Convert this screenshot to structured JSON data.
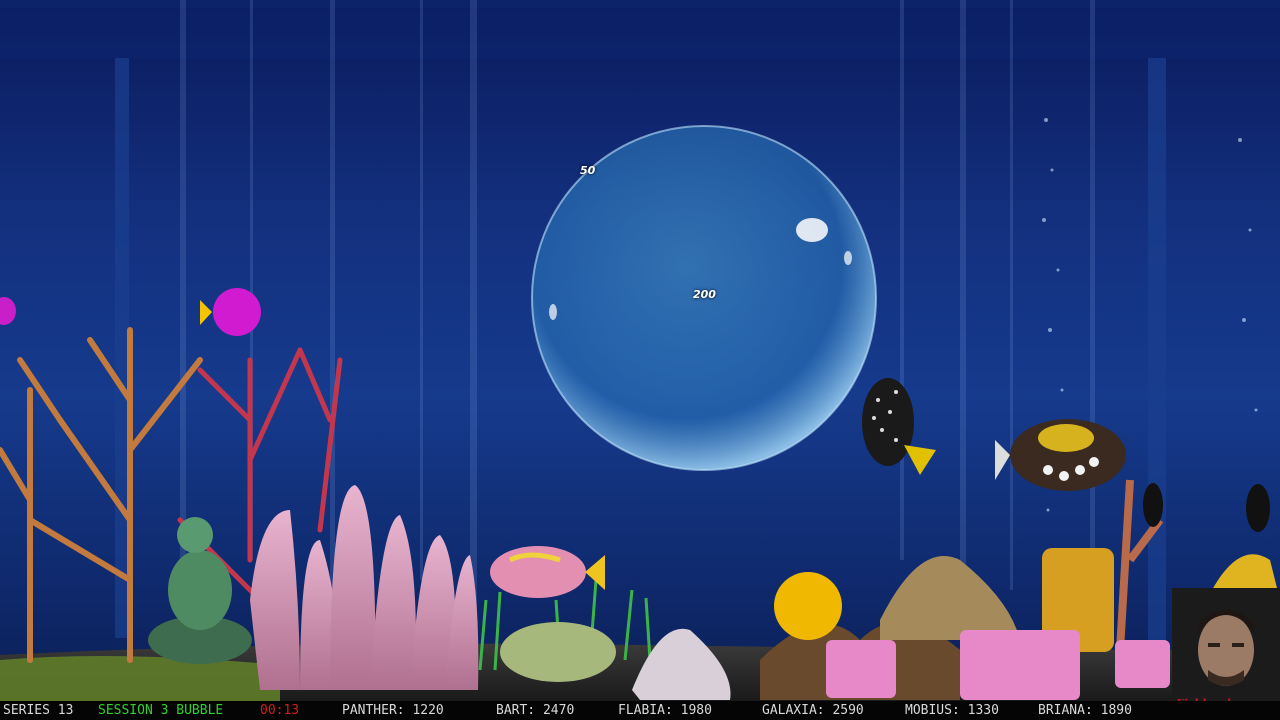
{
  "scene": {
    "bubble": {
      "score_popup": "200"
    },
    "floating_score": "50"
  },
  "status_bar": {
    "series": "SERIES 13",
    "session": "SESSION 3 BUBBLE",
    "timer": "00:13",
    "players": [
      {
        "label": "PANTHER: 1220"
      },
      {
        "label": "BART: 2470"
      },
      {
        "label": "FLABIA: 1980"
      },
      {
        "label": "GALAXIA: 2590"
      },
      {
        "label": "MOBIUS: 1330"
      },
      {
        "label": "BRIANA: 1890"
      }
    ],
    "colors": {
      "series": "#d9d9d9",
      "session": "#2ed12e",
      "timer": "#d11e1e",
      "players": "#d9d9d9"
    }
  },
  "webcam": {
    "logo_text": "Fishbowl"
  }
}
